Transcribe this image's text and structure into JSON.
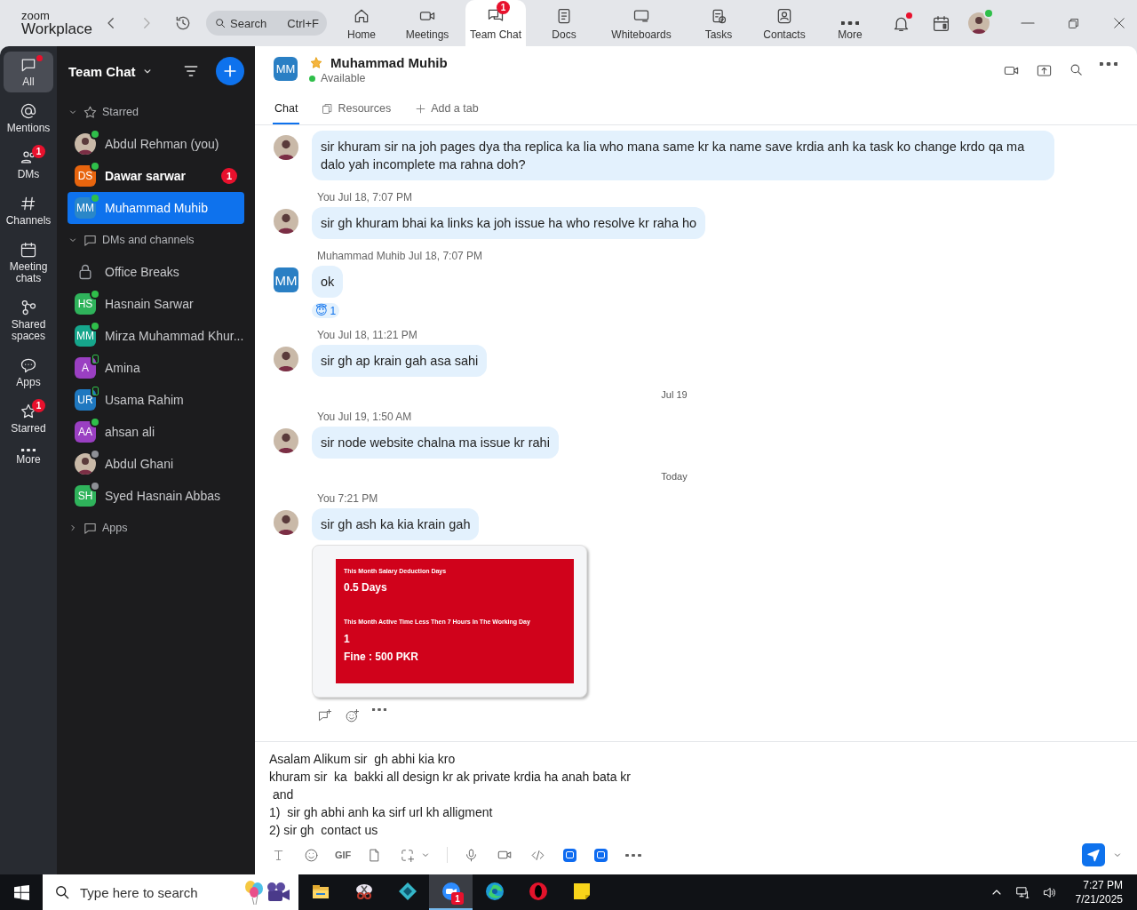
{
  "app": {
    "logo_top": "zoom",
    "logo_bottom": "Workplace",
    "search": {
      "placeholder": "Search",
      "shortcut": "Ctrl+F"
    }
  },
  "nav_tabs": [
    {
      "label": "Home",
      "selected": false
    },
    {
      "label": "Meetings",
      "selected": false
    },
    {
      "label": "Team Chat",
      "selected": true,
      "badge": "1"
    },
    {
      "label": "Docs",
      "selected": false
    },
    {
      "label": "Whiteboards",
      "selected": false
    },
    {
      "label": "Tasks",
      "selected": false
    },
    {
      "label": "Contacts",
      "selected": false
    },
    {
      "label": "More",
      "selected": false
    }
  ],
  "top_right": {
    "notifications_unread": true,
    "presence": {
      "kind": "dot",
      "color": "#2fbf4a"
    }
  },
  "rail": [
    {
      "label": "All",
      "selected": true,
      "dot": true
    },
    {
      "label": "Mentions",
      "selected": false
    },
    {
      "label": "DMs",
      "selected": false,
      "badge": "1"
    },
    {
      "label": "Channels",
      "selected": false
    },
    {
      "label": "Meeting chats",
      "selected": false
    },
    {
      "label": "Shared spaces",
      "selected": false
    },
    {
      "label": "Apps",
      "selected": false
    },
    {
      "label": "Starred",
      "selected": false,
      "badge": "1"
    },
    {
      "label": "More",
      "selected": false
    }
  ],
  "sidebar": {
    "title": "Team Chat",
    "sections": [
      {
        "label": "Starred",
        "expanded": true,
        "items": [
          {
            "name": "Abdul Rehman (you)",
            "avatar": {
              "kind": "photo"
            },
            "presence": {
              "kind": "dot",
              "color": "#2fbf4a"
            },
            "selected": false,
            "unread": false
          },
          {
            "name": "Dawar sarwar",
            "avatar": {
              "kind": "initials",
              "initials": "DS",
              "color": "#e8650e"
            },
            "presence": {
              "kind": "dot",
              "color": "#2fbf4a"
            },
            "selected": false,
            "unread": true,
            "badge": "1"
          },
          {
            "name": "Muhammad Muhib",
            "avatar": {
              "kind": "initials",
              "initials": "MM",
              "color": "#2a87c8"
            },
            "presence": {
              "kind": "dot",
              "color": "#2fbf4a"
            },
            "selected": true,
            "unread": false
          }
        ]
      },
      {
        "label": "DMs and channels",
        "expanded": true,
        "items": [
          {
            "name": "Office Breaks",
            "avatar": {
              "kind": "lock"
            },
            "selected": false,
            "unread": false
          },
          {
            "name": "Hasnain Sarwar",
            "avatar": {
              "kind": "initials",
              "initials": "HS",
              "color": "#2fb35b"
            },
            "presence": {
              "kind": "dot",
              "color": "#2fbf4a"
            },
            "selected": false,
            "unread": false
          },
          {
            "name": "Mirza Muhammad Khur...",
            "avatar": {
              "kind": "initials",
              "initials": "MM",
              "color": "#16a68c"
            },
            "presence": {
              "kind": "dot",
              "color": "#2fbf4a"
            },
            "selected": false,
            "unread": false
          },
          {
            "name": "Amina",
            "avatar": {
              "kind": "initials",
              "initials": "A",
              "color": "#9a3fc2"
            },
            "presence": {
              "kind": "phone",
              "color": "#2fbf4a"
            },
            "selected": false,
            "unread": false
          },
          {
            "name": "Usama Rahim",
            "avatar": {
              "kind": "initials",
              "initials": "UR",
              "color": "#1f78c0"
            },
            "presence": {
              "kind": "phone",
              "color": "#2fbf4a"
            },
            "selected": false,
            "unread": false
          },
          {
            "name": "ahsan ali",
            "avatar": {
              "kind": "initials",
              "initials": "AA",
              "color": "#9a3fc2"
            },
            "presence": {
              "kind": "dot",
              "color": "#2fbf4a"
            },
            "selected": false,
            "unread": false
          },
          {
            "name": "Abdul Ghani",
            "avatar": {
              "kind": "photo"
            },
            "presence": {
              "kind": "dot",
              "color": "#8e9096"
            },
            "selected": false,
            "unread": false
          },
          {
            "name": "Syed Hasnain Abbas",
            "avatar": {
              "kind": "initials",
              "initials": "SH",
              "color": "#2fb35b"
            },
            "presence": {
              "kind": "dot",
              "color": "#8e9096"
            },
            "selected": false,
            "unread": false
          }
        ]
      },
      {
        "label": "Apps",
        "expanded": false
      }
    ]
  },
  "chat": {
    "contact": {
      "name": "Muhammad Muhib",
      "initials": "MM",
      "color": "#2a7fc4",
      "starred": true,
      "status": "Available"
    },
    "tabs": [
      {
        "label": "Chat",
        "selected": true
      },
      {
        "label": "Resources",
        "selected": false
      },
      {
        "label": "Add a tab",
        "selected": false
      }
    ],
    "messages": [
      {
        "kind": "message",
        "avatar": {
          "kind": "photo"
        },
        "text": "sir  khuram sir na joh pages dya tha  replica ka lia who mana same kr ka name save krdia anh ka task ko change krdo qa ma dalo yah incomplete ma rahna doh?"
      },
      {
        "kind": "message",
        "sender": "You",
        "time": "Jul 18, 7:07 PM",
        "avatar": {
          "kind": "photo"
        },
        "text": "sir gh khuram bhai ka links ka joh issue ha who resolve kr raha ho"
      },
      {
        "kind": "message",
        "sender": "Muhammad Muhib",
        "time": "Jul 18, 7:07 PM",
        "avatar": {
          "kind": "initials",
          "initials": "MM",
          "color": "#2a7fc4"
        },
        "text": "ok",
        "reaction": {
          "emoji": "😇",
          "count": "1"
        }
      },
      {
        "kind": "message",
        "sender": "You",
        "time": "Jul 18, 11:21 PM",
        "avatar": {
          "kind": "photo"
        },
        "text": "sir gh ap krain gah asa sahi"
      },
      {
        "kind": "date",
        "label": "Jul 19"
      },
      {
        "kind": "message",
        "sender": "You",
        "time": "Jul 19, 1:50 AM",
        "avatar": {
          "kind": "photo"
        },
        "text": "sir node website chalna ma issue kr rahi"
      },
      {
        "kind": "date",
        "label": "Today"
      },
      {
        "kind": "message",
        "sender": "You",
        "time": "7:21 PM",
        "avatar": {
          "kind": "photo"
        },
        "text": "sir gh ash ka kia krain gah",
        "attachment": {
          "heading_1": "This Month Salary Deduction Days",
          "value_1": "0.5 Days",
          "heading_2": "This Month Active Time Less Then 7 Hours In The Working Day",
          "value_2": "1",
          "fine": "Fine : 500 PKR"
        }
      }
    ],
    "composer": {
      "value": "Asalam Alikum sir  gh abhi kia kro\nkhuram sir  ka  bakki all design kr ak private krdia ha anah bata kr\n and\n1)  sir gh abhi anh ka sirf url kh alligment\n2) sir gh  contact us",
      "gif_label": "GIF"
    }
  },
  "taskbar": {
    "search_placeholder": "Type here to search",
    "apps": [
      {
        "kind": "folder",
        "active": false
      },
      {
        "kind": "snip",
        "active": false
      },
      {
        "kind": "cube",
        "active": false
      },
      {
        "kind": "zoom",
        "active": true,
        "badge": "1"
      },
      {
        "kind": "edge",
        "active": false
      },
      {
        "kind": "opera",
        "active": false
      },
      {
        "kind": "notes",
        "active": false
      }
    ],
    "time": "7:27 PM",
    "date": "7/21/2025"
  }
}
